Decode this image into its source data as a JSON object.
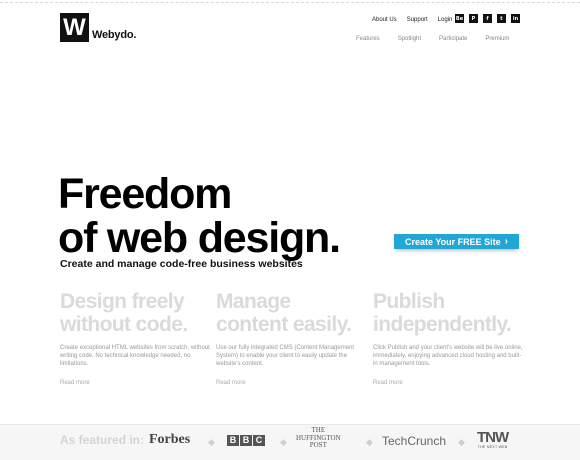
{
  "brand": {
    "logo_letter": "W",
    "name": "Webydo."
  },
  "util_nav": [
    "About Us",
    "Support",
    "Login"
  ],
  "social": [
    {
      "icon": "behance-icon",
      "glyph": "Be"
    },
    {
      "icon": "pinterest-icon",
      "glyph": "P"
    },
    {
      "icon": "facebook-icon",
      "glyph": "f"
    },
    {
      "icon": "twitter-icon",
      "glyph": "t"
    },
    {
      "icon": "linkedin-icon",
      "glyph": "in"
    }
  ],
  "main_nav": [
    "Features",
    "Spotlight",
    "Participate",
    "Premium"
  ],
  "hero": {
    "line1": "Freedom",
    "line2": "of web design."
  },
  "tagline": "Create and manage code-free business websites",
  "cta": {
    "label": "Create Your FREE Site",
    "chevron": "›",
    "color": "#21a7d6"
  },
  "features": [
    {
      "title_line1": "Design freely",
      "title_line2": "without code.",
      "text": "Create exceptional HTML websites from scratch, without writing code. No technical knowledge needed, no limitations.",
      "link": "Read more"
    },
    {
      "title_line1": "Manage",
      "title_line2": "content easily.",
      "text": "Use our fully integrated CMS (Content Management System) to enable your client to easily update the website's content.",
      "link": "Read more"
    },
    {
      "title_line1": "Publish",
      "title_line2": "independently.",
      "text": "Click Publish and your client's website will be live online, immediately, enjoying advanced cloud hosting and built-in management tools.",
      "link": "Read more"
    }
  ],
  "featured": {
    "label": "As featured in:",
    "separator": "◆",
    "forbes": "Forbes",
    "bbc": [
      "B",
      "B",
      "C"
    ],
    "huffington": [
      "THE",
      "HUFFINGTON",
      "POST"
    ],
    "techcrunch": "TechCrunch",
    "tnw": {
      "mark": "TNW",
      "sub": "THE NEXT WEB"
    }
  }
}
